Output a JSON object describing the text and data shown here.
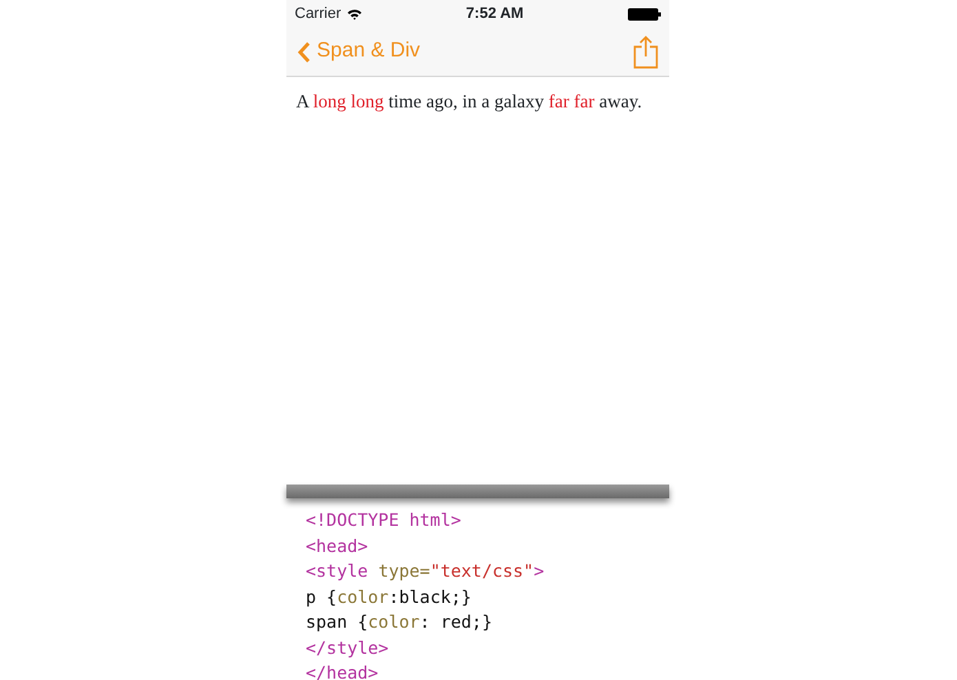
{
  "status_bar": {
    "carrier": "Carrier",
    "time": "7:52 AM"
  },
  "nav_bar": {
    "back_label": "Span & Div"
  },
  "preview": {
    "tokens": [
      {
        "kind": "plain",
        "text": "A "
      },
      {
        "kind": "span",
        "text": "long long"
      },
      {
        "kind": "plain",
        "text": " time ago, in a galaxy "
      },
      {
        "kind": "span",
        "text": "far far"
      },
      {
        "kind": "plain",
        "text": " away."
      }
    ]
  },
  "code_lines": [
    {
      "tokens": [
        {
          "kind": "tag",
          "text": "<!DOCTYPE html>"
        }
      ]
    },
    {
      "tokens": [
        {
          "kind": "tag",
          "text": "<head>"
        }
      ]
    },
    {
      "tokens": [
        {
          "kind": "tag",
          "text": "<style "
        },
        {
          "kind": "attr",
          "text": "type="
        },
        {
          "kind": "string",
          "text": "\"text/css\""
        },
        {
          "kind": "tag",
          "text": ">"
        }
      ]
    },
    {
      "tokens": [
        {
          "kind": "plain",
          "text": "p {"
        },
        {
          "kind": "attr",
          "text": "color"
        },
        {
          "kind": "plain",
          "text": ":black;}"
        }
      ]
    },
    {
      "tokens": [
        {
          "kind": "plain",
          "text": "span {"
        },
        {
          "kind": "attr",
          "text": "color"
        },
        {
          "kind": "plain",
          "text": ": red;}"
        }
      ]
    },
    {
      "tokens": [
        {
          "kind": "tag",
          "text": "</style>"
        }
      ]
    },
    {
      "tokens": [
        {
          "kind": "tag",
          "text": "</head>"
        }
      ]
    }
  ]
}
